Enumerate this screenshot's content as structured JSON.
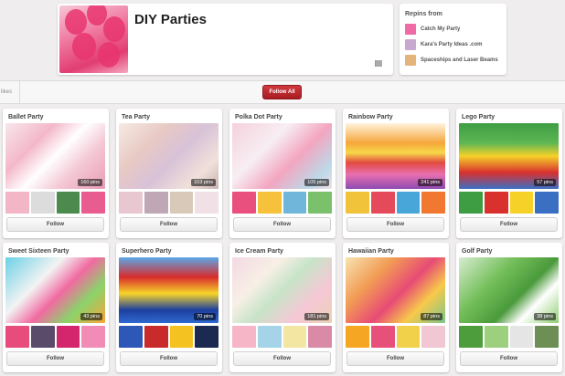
{
  "profile": {
    "title": "DIY Parties",
    "cover_colors": [
      "#f7c7d8",
      "#e23d73"
    ]
  },
  "repins": {
    "heading": "Repins from",
    "sources": [
      {
        "name": "Catch My Party",
        "color": "#f06aa5"
      },
      {
        "name": "Kara's Party Ideas .com",
        "color": "#c9a8cf"
      },
      {
        "name": "Spaceships and Laser Beams",
        "color": "#e4b57a"
      }
    ]
  },
  "toolbar": {
    "likes_label": "likes",
    "follow_all_label": "Follow All"
  },
  "follow_label": "Follow",
  "boards": [
    {
      "title": "Ballet Party",
      "pins": "160 pins",
      "cover": "linear-gradient(135deg,#f9e6ec 0%,#f3b8c9 30%,#fff 50%,#f4c9d6 70%,#e99cb3 100%)",
      "thumbs": [
        "#f2b6c6",
        "#dcdcdc",
        "#4c8a4d",
        "#e85c8f"
      ]
    },
    {
      "title": "Tea Party",
      "pins": "103 pins",
      "cover": "linear-gradient(135deg,#f6eae3 0%,#e8c9c4 30%,#d8c2d8 55%,#f0e0da 80%,#c9b3b3 100%)",
      "thumbs": [
        "#e9c7d0",
        "#bfa7b5",
        "#d9c9b8",
        "#f1e1e6"
      ]
    },
    {
      "title": "Polka Dot Party",
      "pins": "105 pins",
      "cover": "linear-gradient(135deg,#f6d1dc 0%,#f7eef3 35%,#f3a6c0 60%,#bcd9e8 85%,#f0e0e6 100%)",
      "thumbs": [
        "#e9507e",
        "#f6c23c",
        "#6fb6da",
        "#7bc06a"
      ]
    },
    {
      "title": "Rainbow Party",
      "pins": "241 pins",
      "cover": "linear-gradient(180deg,#fff3dc 0%,#f6a63b 30%,#f7d84a 45%,#e24a3f 60%,#e86fb0 78%,#8e4bb1 100%)",
      "thumbs": [
        "#f1c33a",
        "#e54a5a",
        "#48a7d8",
        "#f07830"
      ]
    },
    {
      "title": "Lego Party",
      "pins": "57 pins",
      "cover": "linear-gradient(180deg,#3e9d43 0%,#5db653 30%,#f6d128 50%,#d8312e 75%,#3b6fc4 100%)",
      "thumbs": [
        "#3e9d43",
        "#d8312e",
        "#f6d128",
        "#3b6fc4"
      ]
    },
    {
      "title": "Sweet Sixteen Party",
      "pins": "43 pins",
      "cover": "linear-gradient(135deg,#6bd1e6 0%,#f3f3f3 35%,#f16aa1 55%,#8bd36a 75%,#f9a43a 100%)",
      "thumbs": [
        "#e74c7c",
        "#5a4b6a",
        "#d3266c",
        "#f18cb6"
      ]
    },
    {
      "title": "Superhero Party",
      "pins": "70 pins",
      "cover": "linear-gradient(180deg,#5aa7e8 0%,#d82c2c 30%,#f7d52a 55%,#1d3f9e 80%,#2e6ad1 100%)",
      "thumbs": [
        "#2e58b8",
        "#c92a2a",
        "#f4c322",
        "#1c2a52"
      ]
    },
    {
      "title": "Ice Cream Party",
      "pins": "181 pins",
      "cover": "linear-gradient(135deg,#f3d9e3 0%,#f8efe6 30%,#c7e4c8 50%,#f6c7d5 75%,#e9d2b4 100%)",
      "thumbs": [
        "#f7b6c8",
        "#a5d4e8",
        "#f3e6a3",
        "#d98aa7"
      ]
    },
    {
      "title": "Hawaiian Party",
      "pins": "87 pins",
      "cover": "linear-gradient(135deg,#f7e3b0 0%,#f29b54 30%,#e84b76 55%,#f7c94a 75%,#7bc68b 100%)",
      "thumbs": [
        "#f5a623",
        "#e8507c",
        "#f2d14a",
        "#f0c7d2"
      ]
    },
    {
      "title": "Golf Party",
      "pins": "38 pins",
      "cover": "linear-gradient(135deg,#d7ecd1 0%,#74bf5a 35%,#4a9a3b 60%,#ffffff 75%,#8fcd6f 100%)",
      "thumbs": [
        "#4e9d3c",
        "#9cd07e",
        "#e5e5e5",
        "#6d8f55"
      ]
    }
  ]
}
